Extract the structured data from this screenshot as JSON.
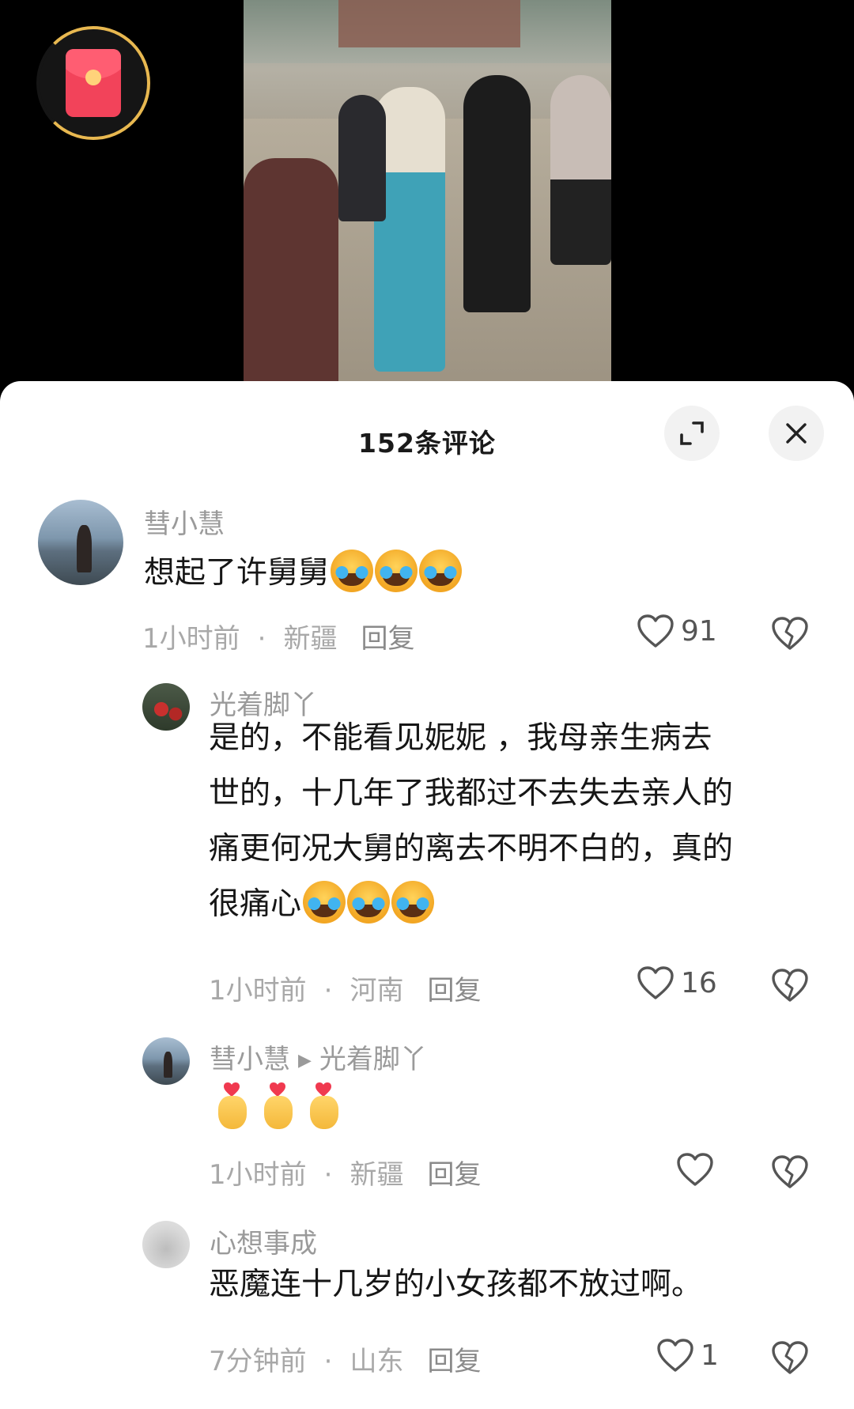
{
  "header": {
    "title": "152条评论"
  },
  "comments": [
    {
      "username": "彗小慧",
      "text": "想起了许舅舅",
      "emoji_count": 3,
      "time": "1小时前",
      "location": "新疆",
      "reply_label": "回复",
      "likes": "91"
    },
    {
      "username": "光着脚丫",
      "text_lines": [
        "是的，不能看见妮妮 ，我母亲生病去",
        "世的，十几年了我都过不去失去亲人的",
        "痛更何况大舅的离去不明不白的，真的",
        "很痛心"
      ],
      "emoji_count": 3,
      "time": "1小时前",
      "location": "河南",
      "reply_label": "回复",
      "likes": "16"
    },
    {
      "username": "彗小慧",
      "reply_to": "光着脚丫",
      "emoji_count": 3,
      "time": "1小时前",
      "location": "新疆",
      "reply_label": "回复",
      "likes": ""
    },
    {
      "username": "心想事成",
      "text": "恶魔连十几岁的小女孩都不放过啊。",
      "time": "7分钟前",
      "location": "山东",
      "reply_label": "回复",
      "likes": "1"
    }
  ],
  "meta_separator": "·",
  "icons": {
    "red_packet": "red-packet-icon",
    "expand": "expand-icon",
    "close": "close-icon",
    "like": "heart-outline-icon",
    "dislike": "broken-heart-icon",
    "reply_arrow": "triangle-right-icon"
  },
  "colors": {
    "red_packet": "#f2435a",
    "ring": "#e8b850",
    "username": "#9a9a9a",
    "meta": "#a8a8a8"
  }
}
